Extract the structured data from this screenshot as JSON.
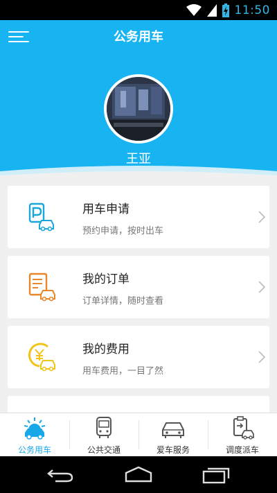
{
  "status_bar": {
    "time": "11:50",
    "icons": [
      "wifi-icon",
      "cell-signal-icon",
      "battery-charging-icon"
    ]
  },
  "header": {
    "title": "公务用车",
    "username": "王亚",
    "menu_icon": "hamburger-menu-icon",
    "background_color": "#18b4f2"
  },
  "cards": [
    {
      "title": "用车申请",
      "subtitle": "预约申请，按时出车",
      "icon": "parking-car-icon",
      "icon_color": "#1aa6d9"
    },
    {
      "title": "我的订单",
      "subtitle": "订单详情，随时查看",
      "icon": "order-list-car-icon",
      "icon_color": "#e8862a"
    },
    {
      "title": "我的费用",
      "subtitle": "用车费用，一目了然",
      "icon": "yen-coin-car-icon",
      "icon_color": "#f0c419"
    }
  ],
  "bottom_nav": [
    {
      "label": "公务用车",
      "icon": "sun-car-icon",
      "active": true
    },
    {
      "label": "公共交通",
      "icon": "bus-icon",
      "active": false
    },
    {
      "label": "爱车服务",
      "icon": "car-service-icon",
      "active": false
    },
    {
      "label": "调度派车",
      "icon": "dispatch-clipboard-car-icon",
      "active": false
    }
  ],
  "system_nav": [
    "back-icon",
    "home-icon",
    "recent-apps-icon"
  ],
  "colors": {
    "accent": "#18b4f2",
    "active_nav": "#18a8e8"
  }
}
